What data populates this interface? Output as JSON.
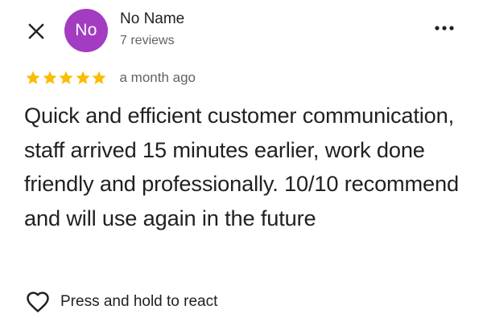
{
  "header": {
    "close_icon": "close-icon",
    "avatar_initials": "No",
    "avatar_color": "#a33cc1",
    "reviewer_name": "No Name",
    "reviewer_reviews": "7 reviews",
    "more_icon": "more-horizontal-icon"
  },
  "review": {
    "rating": 5,
    "rating_max": 5,
    "star_color": "#fbbc04",
    "date": "a month ago",
    "text": "Quick and efficient customer communication, staff arrived 15 minutes earlier, work done friendly and professionally. 10/10 recommend and will use again in the future"
  },
  "react": {
    "icon": "heart-outline-icon",
    "label": "Press and hold to react"
  }
}
